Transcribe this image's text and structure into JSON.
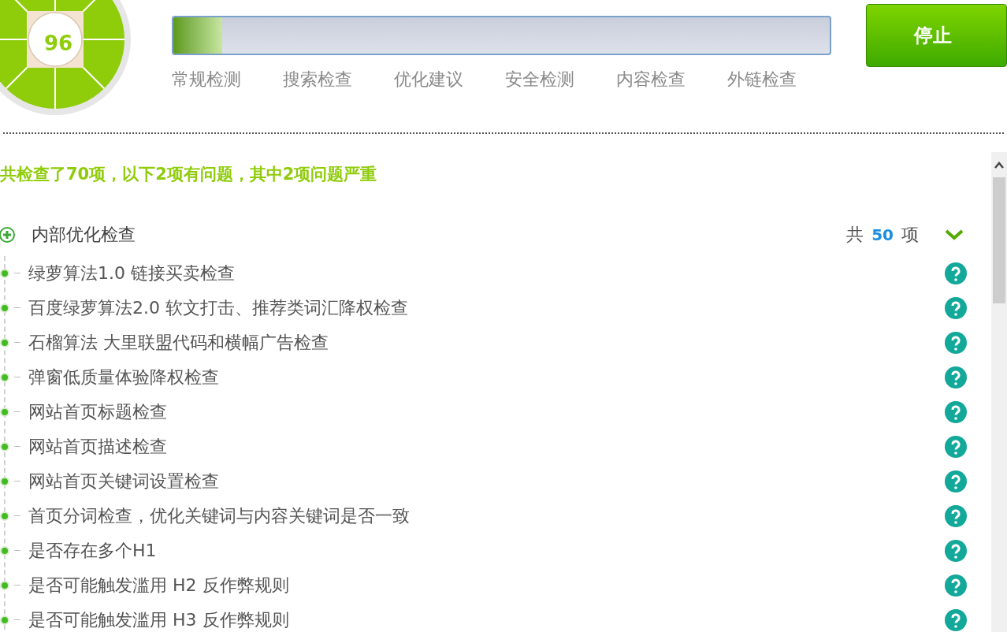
{
  "score": "96",
  "progress": {
    "level": 0.075
  },
  "stop_button": "停止",
  "tabs": [
    {
      "label": "常规检测"
    },
    {
      "label": "搜索检查"
    },
    {
      "label": "优化建议"
    },
    {
      "label": "安全检测"
    },
    {
      "label": "内容检查"
    },
    {
      "label": "外链检查"
    }
  ],
  "summary": "共检查了70项，以下2项有问题，其中2项问题严重",
  "section": {
    "title": "内部优化检查",
    "count_prefix": "共",
    "count": "50",
    "count_suffix": "项",
    "expanded": true,
    "items": [
      {
        "label": "绿萝算法1.0 链接买卖检查"
      },
      {
        "label": "百度绿萝算法2.0 软文打击、推荐类词汇降权检查"
      },
      {
        "label": "石榴算法 大里联盟代码和横幅广告检查"
      },
      {
        "label": "弹窗低质量体验降权检查"
      },
      {
        "label": "网站首页标题检查"
      },
      {
        "label": "网站首页描述检查"
      },
      {
        "label": "网站首页关键词设置检查"
      },
      {
        "label": "首页分词检查，优化关键词与内容关键词是否一致"
      },
      {
        "label": "是否存在多个H1"
      },
      {
        "label": "是否可能触发滥用 H2 反作弊规则"
      },
      {
        "label": "是否可能触发滥用 H3 反作弊规则"
      }
    ]
  }
}
